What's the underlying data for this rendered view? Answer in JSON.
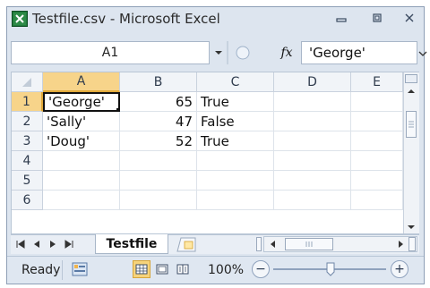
{
  "window": {
    "title": "Testfile.csv - Microsoft Excel",
    "app_icon": "excel-icon",
    "controls": [
      "minimize-icon",
      "restore-icon",
      "close-icon"
    ]
  },
  "formula_bar": {
    "name_box": "A1",
    "fx_label": "fx",
    "content": "'George'"
  },
  "sheet": {
    "columns": [
      "A",
      "B",
      "C",
      "D",
      "E"
    ],
    "rows": [
      "1",
      "2",
      "3",
      "4",
      "5",
      "6"
    ],
    "selected_cell": "A1",
    "cells": [
      [
        "'George'",
        "65",
        "True",
        "",
        ""
      ],
      [
        "'Sally'",
        "47",
        "False",
        "",
        ""
      ],
      [
        "'Doug'",
        "52",
        "True",
        "",
        ""
      ],
      [
        "",
        "",
        "",
        "",
        ""
      ],
      [
        "",
        "",
        "",
        "",
        ""
      ],
      [
        "",
        "",
        "",
        "",
        ""
      ]
    ]
  },
  "tabs": {
    "active": "Testfile"
  },
  "status": {
    "ready": "Ready",
    "zoom": "100%",
    "zoom_minus": "−",
    "zoom_plus": "+"
  }
}
